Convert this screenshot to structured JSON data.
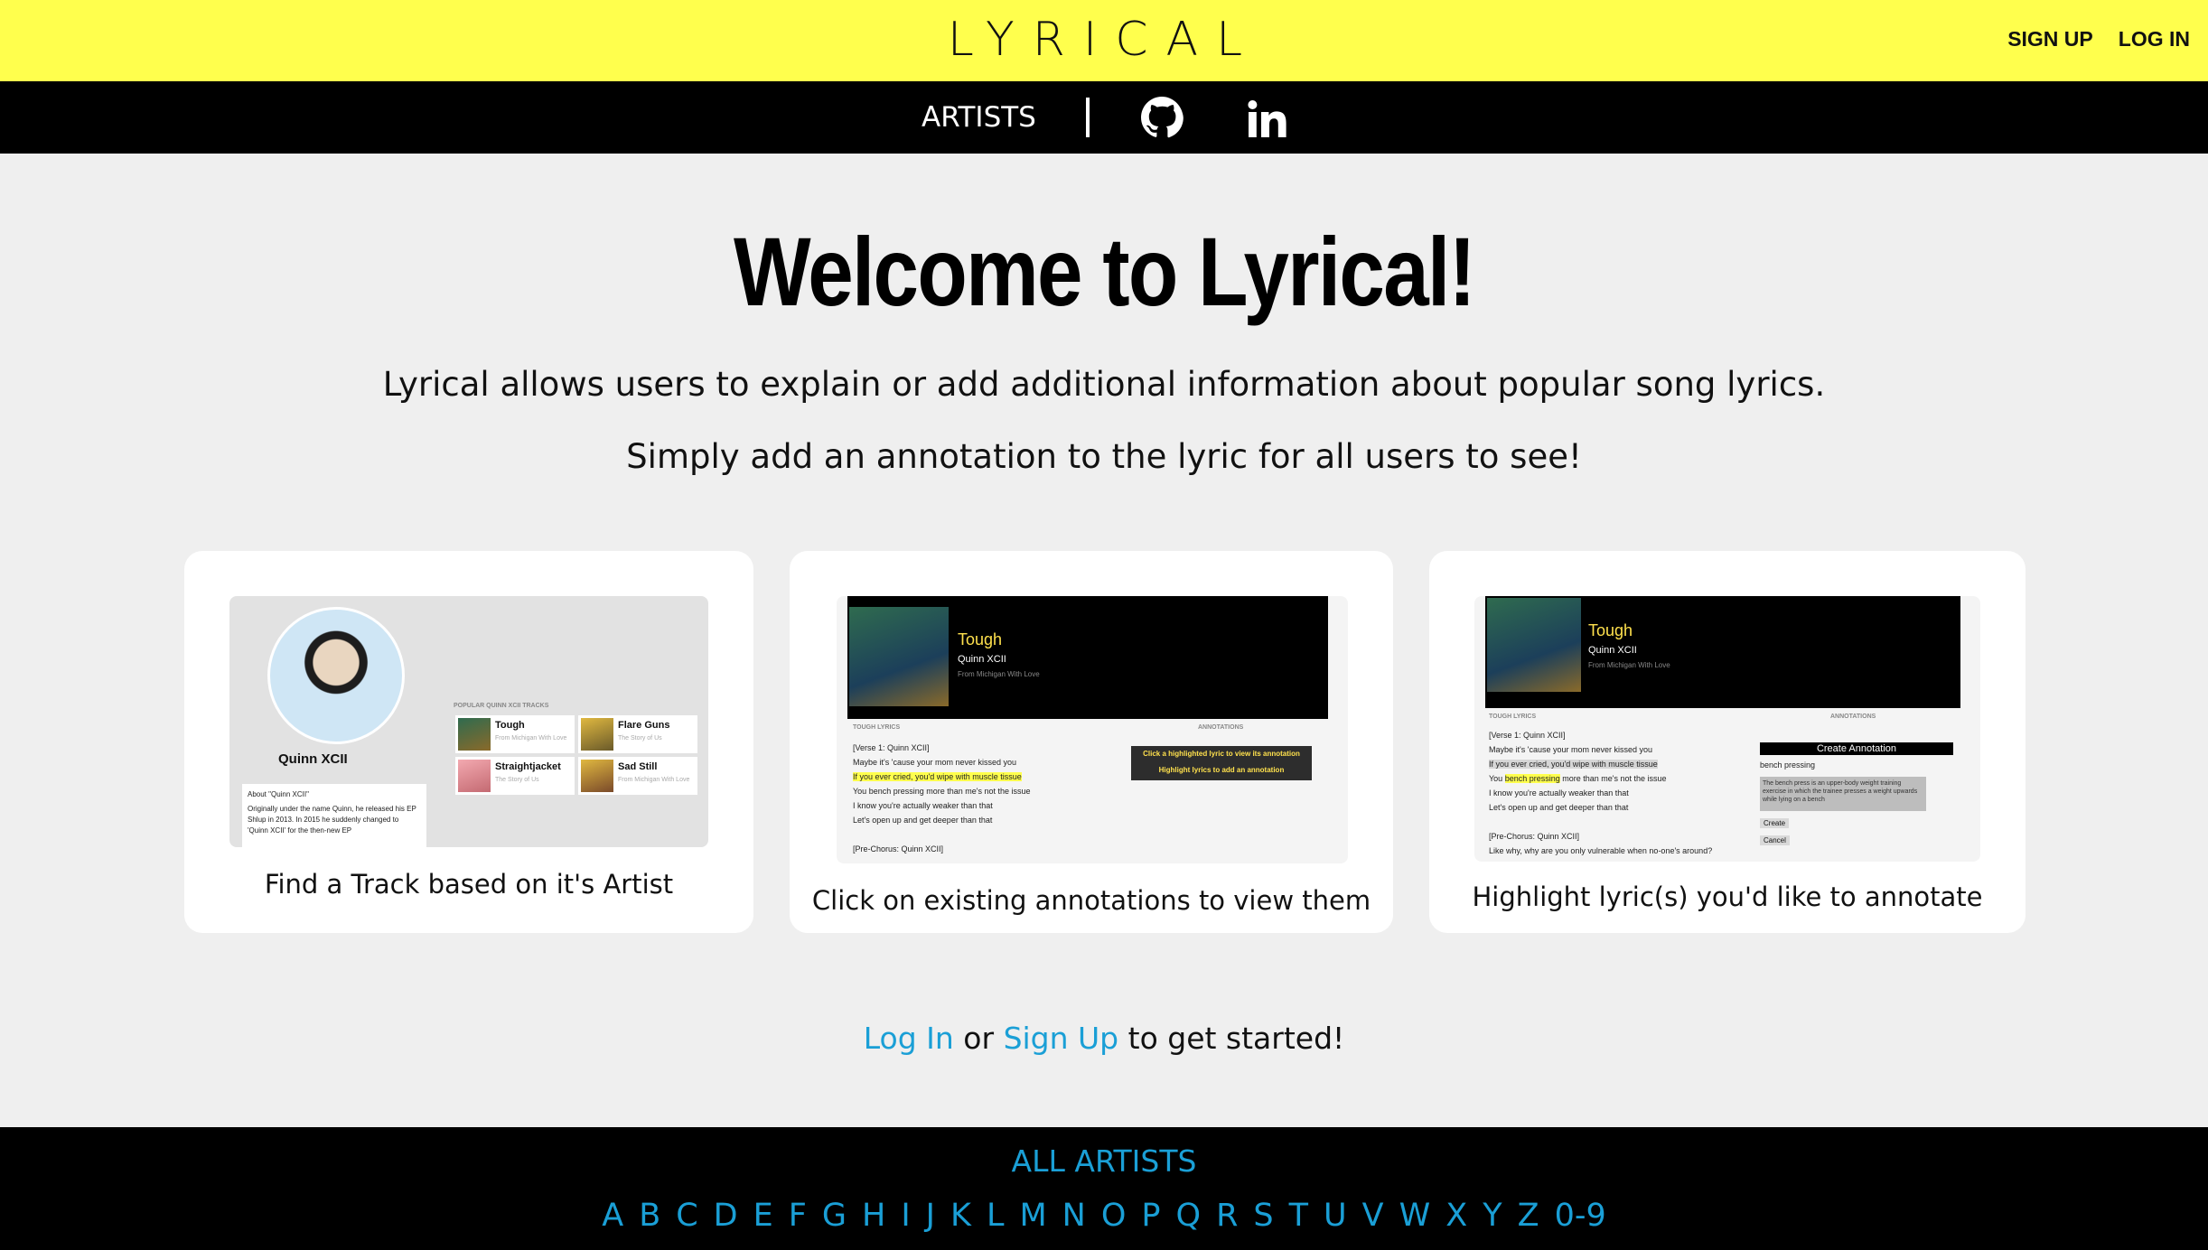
{
  "header": {
    "logo": "LYRICAL",
    "sign_up": "SIGN UP",
    "log_in": "LOG IN"
  },
  "nav": {
    "artists": "ARTISTS",
    "github_icon": "github-icon",
    "linkedin_icon": "linkedin-icon"
  },
  "main": {
    "title": "Welcome to Lyrical!",
    "subtitle1": "Lyrical allows users to explain or add additional information about popular song lyrics.",
    "subtitle2": "Simply add an annotation to the lyric for all users to see!"
  },
  "cards": [
    {
      "caption": "Find a Track based on it's Artist",
      "artist_name": "Quinn XCII",
      "about_title": "About \"Quinn XCII\"",
      "about_text": "Originally under the name Quinn, he released his EP Shlup in 2013. In 2015 he suddenly changed to 'Quinn XCII' for the then-new EP",
      "popular_label": "POPULAR QUINN XCII TRACKS",
      "tracks": [
        {
          "name": "Tough",
          "album": "From Michigan With Love"
        },
        {
          "name": "Flare Guns",
          "album": "The Story of Us"
        },
        {
          "name": "Straightjacket",
          "album": "The Story of Us"
        },
        {
          "name": "Sad Still",
          "album": "From Michigan With Love"
        }
      ]
    },
    {
      "caption": "Click on existing annotations to view them",
      "song_title": "Tough",
      "song_artist": "Quinn XCII",
      "song_album": "From Michigan With Love",
      "lyrics_label": "TOUGH LYRICS",
      "annotations_label": "ANNOTATIONS",
      "lyrics": [
        "[Verse 1: Quinn XCII]",
        "Maybe it's 'cause your mom never kissed you",
        "If you ever cried, you'd wipe with muscle tissue",
        "You bench pressing more than me's not the issue",
        "I know you're actually weaker than that",
        "Let's open up and get deeper than that",
        "",
        "[Pre-Chorus: Quinn XCII]"
      ],
      "annotation_hint1": "Click a highlighted lyric to view its annotation",
      "annotation_hint2": "Highlight lyrics to add an annotation"
    },
    {
      "caption": "Highlight lyric(s) you'd like to annotate",
      "song_title": "Tough",
      "song_artist": "Quinn XCII",
      "song_album": "From Michigan With Love",
      "lyrics_label": "TOUGH LYRICS",
      "annotations_label": "ANNOTATIONS",
      "lyrics_l1": "[Verse 1: Quinn XCII]",
      "lyrics_l2": "Maybe it's 'cause your mom never kissed you",
      "lyrics_l3": "If you ever cried, you'd wipe with muscle tissue",
      "lyrics_l4_pre": "You ",
      "lyrics_l4_hl": "bench pressing",
      "lyrics_l4_post": " more than me's not the issue",
      "lyrics_l5": "I know you're actually weaker than that",
      "lyrics_l6": "Let's open up and get deeper than that",
      "lyrics_l8": "[Pre-Chorus: Quinn XCII]",
      "lyrics_l9": "Like why, why are you only vulnerable when no-one's around?",
      "create_title": "Create Annotation",
      "create_lyric": "bench pressing",
      "create_text": "The bench press is an upper-body weight training exercise in which the trainee presses a weight upwards while lying on a bench",
      "create_btn": "Create",
      "cancel_btn": "Cancel"
    }
  ],
  "cta": {
    "login": "Log In",
    "or": " or ",
    "signup": "Sign Up",
    "rest": " to get started!"
  },
  "footer": {
    "all_artists": "ALL ARTISTS",
    "letters": [
      "A",
      "B",
      "C",
      "D",
      "E",
      "F",
      "G",
      "H",
      "I",
      "J",
      "K",
      "L",
      "M",
      "N",
      "O",
      "P",
      "Q",
      "R",
      "S",
      "T",
      "U",
      "V",
      "W",
      "X",
      "Y",
      "Z",
      "0-9"
    ]
  },
  "colors": {
    "header_bg": "#ffff4d",
    "nav_bg": "#000000",
    "link": "#1a9fd6",
    "page_bg": "#efefef"
  }
}
